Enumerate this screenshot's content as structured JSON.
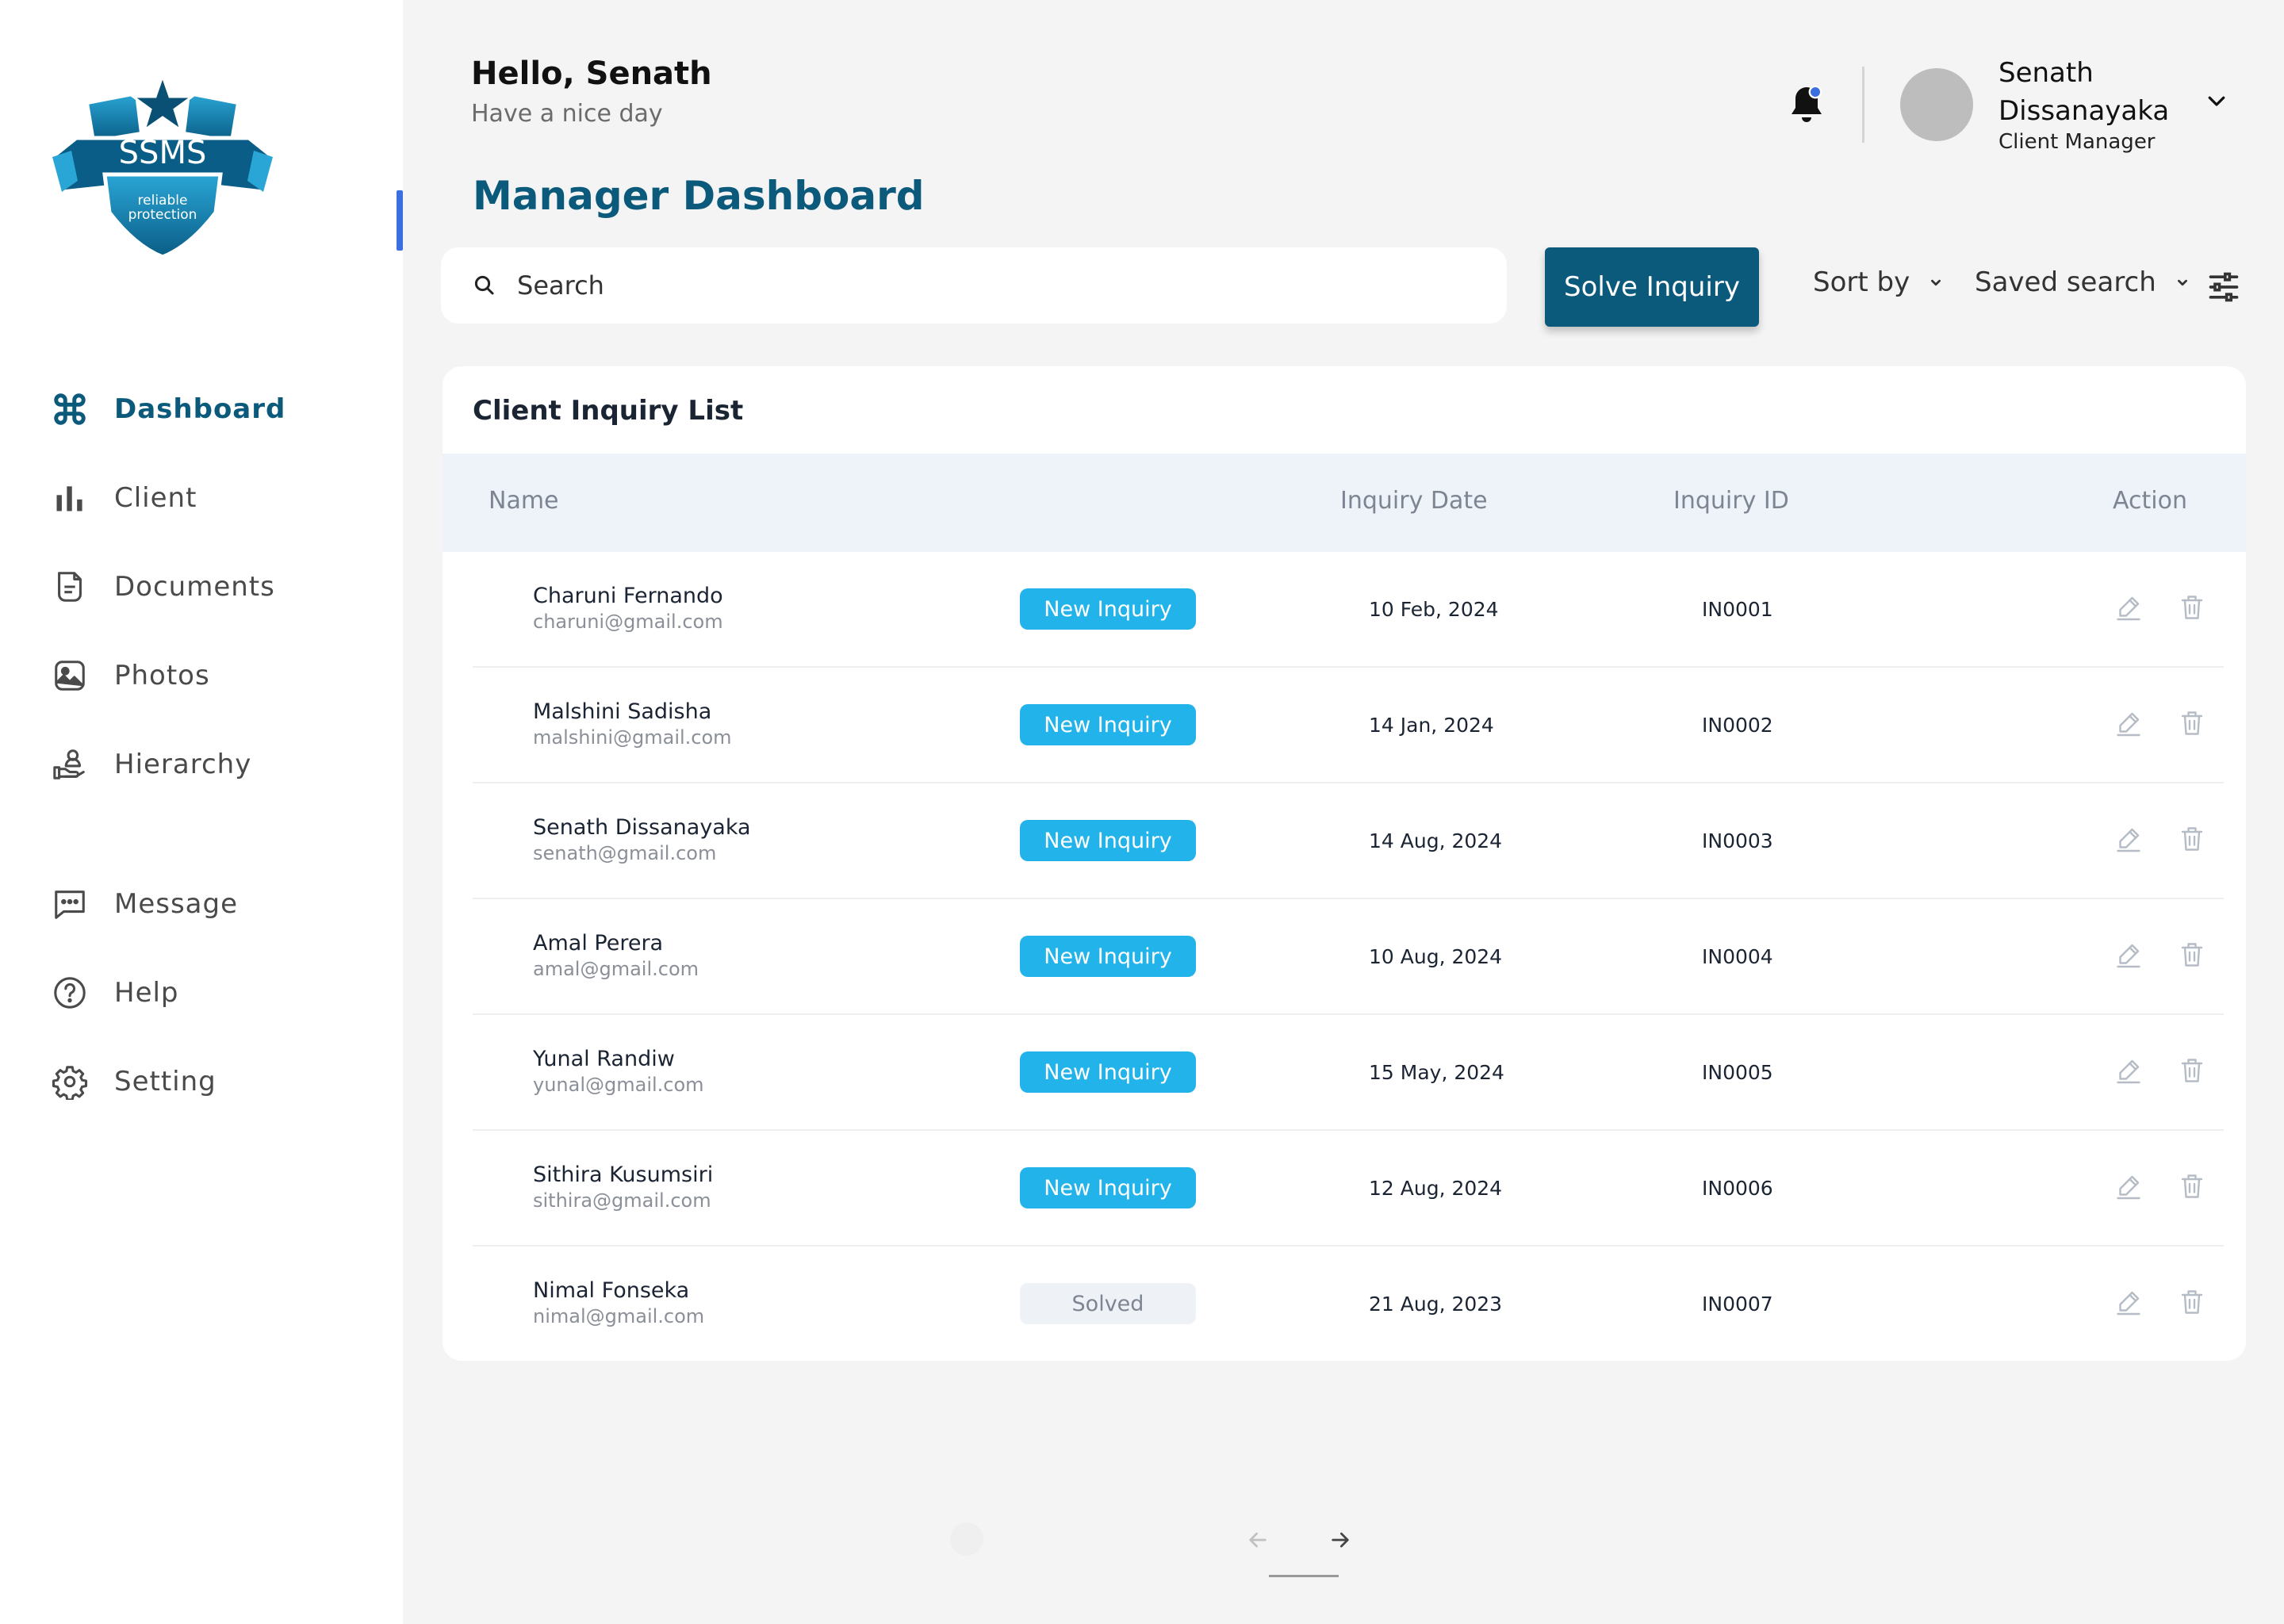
{
  "brand": {
    "logo_text": "SSMS",
    "logo_tagline_1": "reliable",
    "logo_tagline_2": "protection"
  },
  "sidebar": {
    "items": [
      {
        "label": "Dashboard",
        "icon": "command-icon",
        "active": true
      },
      {
        "label": "Client",
        "icon": "bar-chart-icon"
      },
      {
        "label": "Documents",
        "icon": "document-icon"
      },
      {
        "label": "Photos",
        "icon": "image-icon"
      },
      {
        "label": "Hierarchy",
        "icon": "hand-holding-user-icon"
      },
      {
        "label": "Message",
        "icon": "chat-icon"
      },
      {
        "label": "Help",
        "icon": "help-icon"
      },
      {
        "label": "Setting",
        "icon": "gear-icon"
      }
    ]
  },
  "header": {
    "greeting": "Hello, Senath",
    "greeting_sub": "Have a nice day",
    "page_title": "Manager Dashboard",
    "user": {
      "name": "Senath Dissanayaka",
      "role": "Client Manager"
    }
  },
  "toolbar": {
    "search_placeholder": "Search",
    "solve_label": "Solve Inquiry",
    "sort_label": "Sort by",
    "saved_search_label": "Saved search"
  },
  "table": {
    "title": "Client Inquiry List",
    "columns": {
      "name": "Name",
      "date": "Inquiry Date",
      "id": "Inquiry ID",
      "action": "Action"
    },
    "rows": [
      {
        "name": "Charuni Fernando",
        "email": "charuni@gmail.com",
        "status": "New Inquiry",
        "date": "10 Feb, 2024",
        "id": "IN0001"
      },
      {
        "name": "Malshini Sadisha",
        "email": "malshini@gmail.com",
        "status": "New Inquiry",
        "date": "14 Jan, 2024",
        "id": "IN0002"
      },
      {
        "name": "Senath Dissanayaka",
        "email": "senath@gmail.com",
        "status": "New Inquiry",
        "date": "14 Aug, 2024",
        "id": "IN0003"
      },
      {
        "name": "Amal Perera",
        "email": "amal@gmail.com",
        "status": "New Inquiry",
        "date": "10 Aug, 2024",
        "id": "IN0004"
      },
      {
        "name": "Yunal Randiw",
        "email": "yunal@gmail.com",
        "status": "New Inquiry",
        "date": "15 May, 2024",
        "id": "IN0005"
      },
      {
        "name": "Sithira Kusumsiri",
        "email": "sithira@gmail.com",
        "status": "New Inquiry",
        "date": "12 Aug, 2024",
        "id": "IN0006"
      },
      {
        "name": "Nimal Fonseka",
        "email": "nimal@gmail.com",
        "status": "Solved",
        "date": "21 Aug, 2023",
        "id": "IN0007"
      }
    ]
  },
  "colors": {
    "primary": "#0b5a7c",
    "badge_new": "#22b3ea",
    "badge_solved": "#eef2f7",
    "accent_marker": "#3b6fe0",
    "notification_dot": "#3b6fe0"
  }
}
